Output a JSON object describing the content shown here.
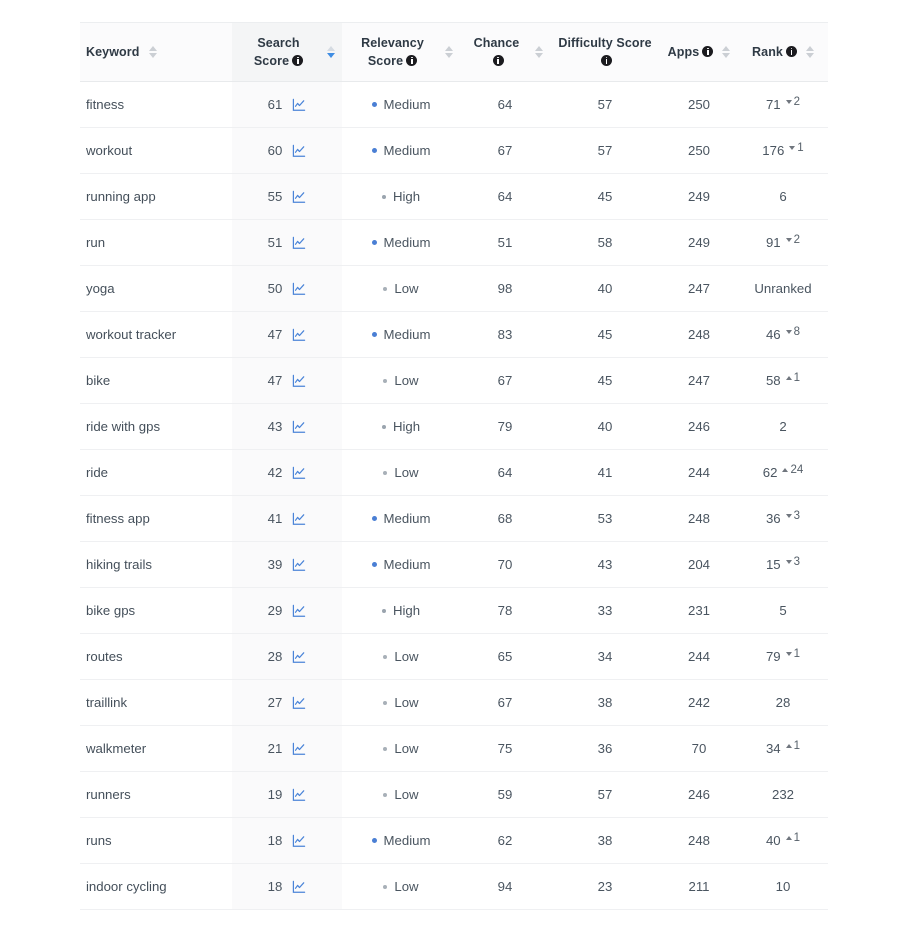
{
  "table": {
    "columns": [
      {
        "key": "keyword",
        "label": "Keyword",
        "info": false,
        "sortable": true,
        "sort_state": "none",
        "align": "left",
        "highlight": false
      },
      {
        "key": "search",
        "label": "Search Score",
        "info": true,
        "sortable": true,
        "sort_state": "desc",
        "align": "center",
        "highlight": true
      },
      {
        "key": "relevancy",
        "label": "Relevancy Score",
        "info": true,
        "sortable": true,
        "sort_state": "none",
        "align": "center",
        "highlight": false
      },
      {
        "key": "chance",
        "label": "Chance",
        "info": true,
        "sortable": true,
        "sort_state": "none",
        "align": "center",
        "highlight": false
      },
      {
        "key": "difficulty",
        "label": "Difficulty Score",
        "info": true,
        "sortable": false,
        "sort_state": "none",
        "align": "center",
        "highlight": false
      },
      {
        "key": "apps",
        "label": "Apps",
        "info": true,
        "sortable": true,
        "sort_state": "none",
        "align": "center",
        "highlight": false
      },
      {
        "key": "rank",
        "label": "Rank",
        "info": true,
        "sortable": true,
        "sort_state": "none",
        "align": "center",
        "highlight": false
      }
    ],
    "icons": {
      "chart": "line-chart-icon",
      "info": "info-icon",
      "sort": "sort-arrows-icon",
      "rank_up": "arrow-up-icon",
      "rank_down": "arrow-down-icon"
    },
    "colors": {
      "accent_blue": "#3f8de3",
      "chart_icon": "#4a84d8",
      "dot_medium": "#4a7fd4",
      "dot_high": "#9aa4ae",
      "dot_low": "#a8b0b8",
      "row_border": "#eff0f2",
      "header_bg": "#fbfbfc",
      "highlight_col_bg": "#f4f5f6",
      "text": "#4a5560"
    },
    "rows": [
      {
        "keyword": "fitness",
        "search": "61",
        "relevancy": "Medium",
        "rel_level": "medium",
        "chance": "64",
        "difficulty": "57",
        "apps": "250",
        "rank": "71",
        "delta": "2",
        "delta_dir": "down"
      },
      {
        "keyword": "workout",
        "search": "60",
        "relevancy": "Medium",
        "rel_level": "medium",
        "chance": "67",
        "difficulty": "57",
        "apps": "250",
        "rank": "176",
        "delta": "1",
        "delta_dir": "down"
      },
      {
        "keyword": "running app",
        "search": "55",
        "relevancy": "High",
        "rel_level": "high",
        "chance": "64",
        "difficulty": "45",
        "apps": "249",
        "rank": "6",
        "delta": "",
        "delta_dir": "none"
      },
      {
        "keyword": "run",
        "search": "51",
        "relevancy": "Medium",
        "rel_level": "medium",
        "chance": "51",
        "difficulty": "58",
        "apps": "249",
        "rank": "91",
        "delta": "2",
        "delta_dir": "down"
      },
      {
        "keyword": "yoga",
        "search": "50",
        "relevancy": "Low",
        "rel_level": "low",
        "chance": "98",
        "difficulty": "40",
        "apps": "247",
        "rank": "Unranked",
        "delta": "",
        "delta_dir": "none"
      },
      {
        "keyword": "workout tracker",
        "search": "47",
        "relevancy": "Medium",
        "rel_level": "medium",
        "chance": "83",
        "difficulty": "45",
        "apps": "248",
        "rank": "46",
        "delta": "8",
        "delta_dir": "down"
      },
      {
        "keyword": "bike",
        "search": "47",
        "relevancy": "Low",
        "rel_level": "low",
        "chance": "67",
        "difficulty": "45",
        "apps": "247",
        "rank": "58",
        "delta": "1",
        "delta_dir": "up"
      },
      {
        "keyword": "ride with gps",
        "search": "43",
        "relevancy": "High",
        "rel_level": "high",
        "chance": "79",
        "difficulty": "40",
        "apps": "246",
        "rank": "2",
        "delta": "",
        "delta_dir": "none"
      },
      {
        "keyword": "ride",
        "search": "42",
        "relevancy": "Low",
        "rel_level": "low",
        "chance": "64",
        "difficulty": "41",
        "apps": "244",
        "rank": "62",
        "delta": "24",
        "delta_dir": "up"
      },
      {
        "keyword": "fitness app",
        "search": "41",
        "relevancy": "Medium",
        "rel_level": "medium",
        "chance": "68",
        "difficulty": "53",
        "apps": "248",
        "rank": "36",
        "delta": "3",
        "delta_dir": "down"
      },
      {
        "keyword": "hiking trails",
        "search": "39",
        "relevancy": "Medium",
        "rel_level": "medium",
        "chance": "70",
        "difficulty": "43",
        "apps": "204",
        "rank": "15",
        "delta": "3",
        "delta_dir": "down"
      },
      {
        "keyword": "bike gps",
        "search": "29",
        "relevancy": "High",
        "rel_level": "high",
        "chance": "78",
        "difficulty": "33",
        "apps": "231",
        "rank": "5",
        "delta": "",
        "delta_dir": "none"
      },
      {
        "keyword": "routes",
        "search": "28",
        "relevancy": "Low",
        "rel_level": "low",
        "chance": "65",
        "difficulty": "34",
        "apps": "244",
        "rank": "79",
        "delta": "1",
        "delta_dir": "down"
      },
      {
        "keyword": "traillink",
        "search": "27",
        "relevancy": "Low",
        "rel_level": "low",
        "chance": "67",
        "difficulty": "38",
        "apps": "242",
        "rank": "28",
        "delta": "",
        "delta_dir": "none"
      },
      {
        "keyword": "walkmeter",
        "search": "21",
        "relevancy": "Low",
        "rel_level": "low",
        "chance": "75",
        "difficulty": "36",
        "apps": "70",
        "rank": "34",
        "delta": "1",
        "delta_dir": "up"
      },
      {
        "keyword": "runners",
        "search": "19",
        "relevancy": "Low",
        "rel_level": "low",
        "chance": "59",
        "difficulty": "57",
        "apps": "246",
        "rank": "232",
        "delta": "",
        "delta_dir": "none"
      },
      {
        "keyword": "runs",
        "search": "18",
        "relevancy": "Medium",
        "rel_level": "medium",
        "chance": "62",
        "difficulty": "38",
        "apps": "248",
        "rank": "40",
        "delta": "1",
        "delta_dir": "up"
      },
      {
        "keyword": "indoor cycling",
        "search": "18",
        "relevancy": "Low",
        "rel_level": "low",
        "chance": "94",
        "difficulty": "23",
        "apps": "211",
        "rank": "10",
        "delta": "",
        "delta_dir": "none"
      }
    ]
  }
}
